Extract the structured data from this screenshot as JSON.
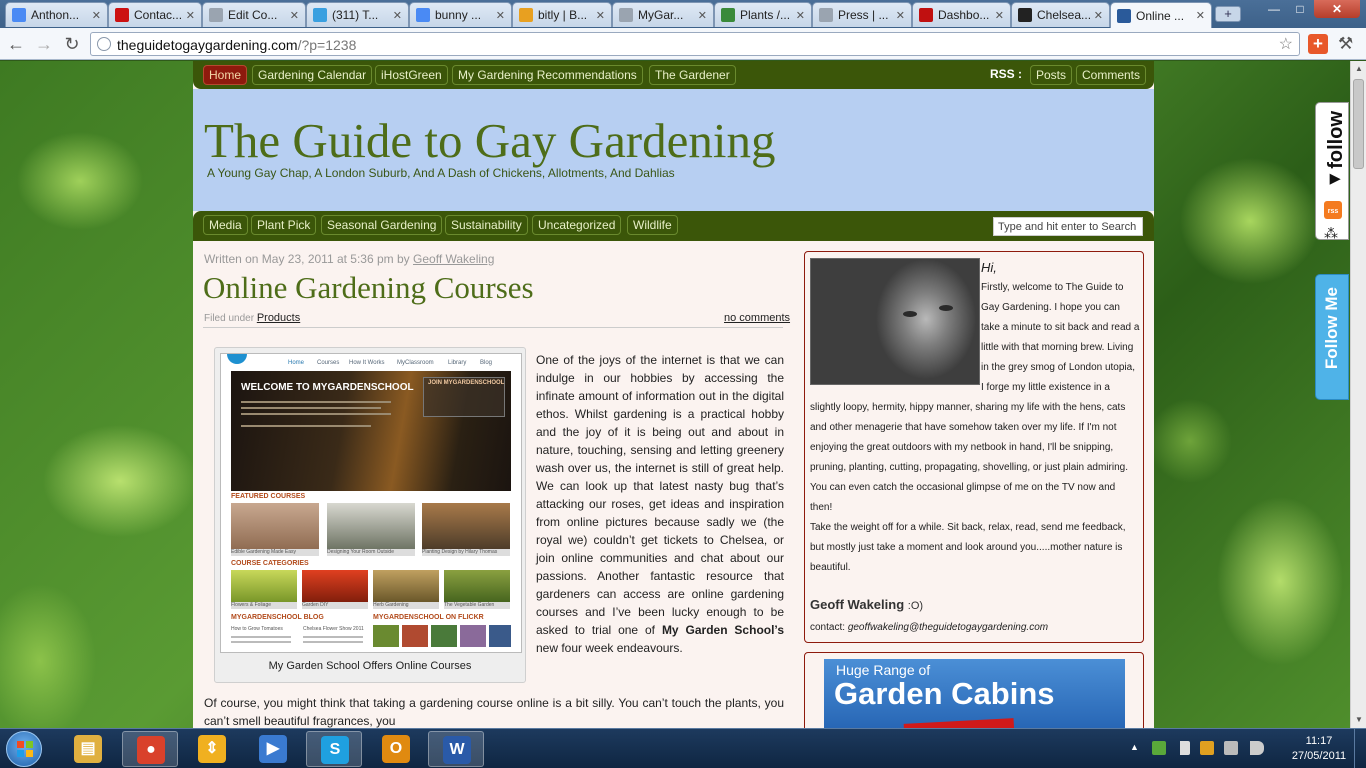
{
  "browser": {
    "tabs": [
      {
        "label": "Anthon...",
        "favicon": "google-icon",
        "color": "#4a8af4"
      },
      {
        "label": "Contac...",
        "favicon": "opera-icon",
        "color": "#cc1111"
      },
      {
        "label": "Edit Co...",
        "favicon": "page-icon",
        "color": "#9aa4b0"
      },
      {
        "label": "(311) T...",
        "favicon": "twitter-icon",
        "color": "#3aa0e0"
      },
      {
        "label": "bunny ...",
        "favicon": "google-icon",
        "color": "#4a8af4"
      },
      {
        "label": "bitly | B...",
        "favicon": "bitly-icon",
        "color": "#e8a020"
      },
      {
        "label": "MyGar...",
        "favicon": "page-icon",
        "color": "#9aa4b0"
      },
      {
        "label": "Plants /...",
        "favicon": "leaf-icon",
        "color": "#3a8a3a"
      },
      {
        "label": "Press | ...",
        "favicon": "page-icon",
        "color": "#9aa4b0"
      },
      {
        "label": "Dashbo...",
        "favicon": "oc-icon",
        "color": "#c01010"
      },
      {
        "label": "Chelsea...",
        "favicon": "telegraph-icon",
        "color": "#222222"
      },
      {
        "label": "Online ...",
        "favicon": "site-icon",
        "color": "#2a5a9a"
      }
    ],
    "url_host": "theguidetogaygardening.com",
    "url_query": "/?p=1238"
  },
  "site": {
    "topnav": [
      "Home",
      "Gardening Calendar",
      "iHostGreen",
      "My Gardening Recommendations",
      "The Gardener"
    ],
    "rss_label": "RSS :",
    "rss_links": [
      "Posts",
      "Comments"
    ],
    "title": "The Guide to Gay Gardening",
    "tagline": "A Young Gay Chap, A London Suburb, And A Dash of Chickens, Allotments, And Dahlias",
    "categories": [
      "Media",
      "Plant Pick",
      "Seasonal Gardening",
      "Sustainability",
      "Uncategorized",
      "Wildlife"
    ],
    "search_placeholder": "Type and hit enter to Search"
  },
  "post": {
    "meta_prefix": "Written on May 23, 2011 at 5:36 pm by",
    "author": "Geoff Wakeling",
    "title": "Online Gardening Courses",
    "filed_prefix": "Filed under",
    "category": "Products",
    "comments": "no comments",
    "caption": "My Garden School Offers Online Courses",
    "body_1": "One of the joys of the internet is that we can indulge in our hobbies by accessing the infinate amount of information out in the digital ethos. Whilst gardening is a practical hobby and the joy of it is being out and about in nature, touching, sensing and letting greenery wash over us, the internet is still of great help. We can look up that latest nasty bug that’s attacking our roses, get ideas and inspiration from online pictures because sadly we (the royal we) couldn’t get tickets to Chelsea, or join online communities and chat about our passions. Another fantastic resource that gardeners can access are online gardening courses and I’ve been lucky enough to be asked to trial one of",
    "body_bold": "My Garden School’s",
    "body_1_end": "new four week endeavours.",
    "body_2": "Of course, you might think that taking a gardening course online is a bit silly. You can’t touch the plants, you can’t smell beautiful fragrances, you"
  },
  "screenshot": {
    "nav": [
      "Home",
      "Courses",
      "How It Works",
      "MyClassroom",
      "Library",
      "Blog"
    ],
    "hero_title": "WELCOME TO MYGARDENSCHOOL",
    "join_title": "JOIN MYGARDENSCHOOL",
    "featured": "FEATURED COURSES",
    "featured_caps": [
      "Edible Gardening Made Easy",
      "Designing Your Room Outside",
      "Planting Design by Hilary Thomas"
    ],
    "categories": "COURSE CATEGORIES",
    "category_caps": [
      "Flowers & Foliage",
      "Garden DIY",
      "Herb Gardening",
      "The Vegetable Garden"
    ],
    "blog": "MYGARDENSCHOOL BLOG",
    "blog_items": [
      "How to Grow Tomatoes",
      "Chelsea Flower Show 2011"
    ],
    "flickr": "MYGARDENSCHOOL ON FLICKR"
  },
  "sidebar": {
    "greeting": "Hi,",
    "about": "Firstly, welcome to The Guide to Gay Gardening. I hope you can take a minute to sit back and read a little with that morning brew. Living in the grey smog of London utopia, I forge my little existence in a slightly loopy, hermity, hippy manner, sharing my life with the hens, cats and other menagerie that have somehow taken over my life. If I'm not enjoying the great outdoors with my netbook in hand, I'll be snipping, pruning, planting, cutting, propagating, shovelling, or just plain admiring. You can even catch the occasional glimpse of me on the TV now and then!",
    "about_2": "Take the weight off for a while. Sit back, relax, read, send me feedback, but mostly just take a moment and look around you.....mother nature is beautiful.",
    "signature": "Geoff Wakeling",
    "signature_emote": ":O)",
    "contact_label": "contact:",
    "contact_email": "geoffwakeling@theguidetogaygardening.com",
    "ad_line1": "Huge Range of",
    "ad_line2": "Garden Cabins"
  },
  "widget": {
    "follow": "◂follow",
    "rss": "rss",
    "follow_me": "Follow Me"
  },
  "taskbar": {
    "apps": [
      {
        "name": "explorer-icon",
        "color": "#e0b040",
        "glyph": "▤"
      },
      {
        "name": "chrome-icon",
        "color": "#d9412b",
        "glyph": "●"
      },
      {
        "name": "updater-icon",
        "color": "#f0b020",
        "glyph": "⇕"
      },
      {
        "name": "media-player-icon",
        "color": "#3a7ad0",
        "glyph": "▶"
      },
      {
        "name": "skype-icon",
        "color": "#1fa0e0",
        "glyph": "S"
      },
      {
        "name": "outlook-icon",
        "color": "#e08a10",
        "glyph": "O"
      },
      {
        "name": "word-icon",
        "color": "#2a5aa8",
        "glyph": "W"
      }
    ],
    "time": "11:17",
    "date": "27/05/2011"
  }
}
